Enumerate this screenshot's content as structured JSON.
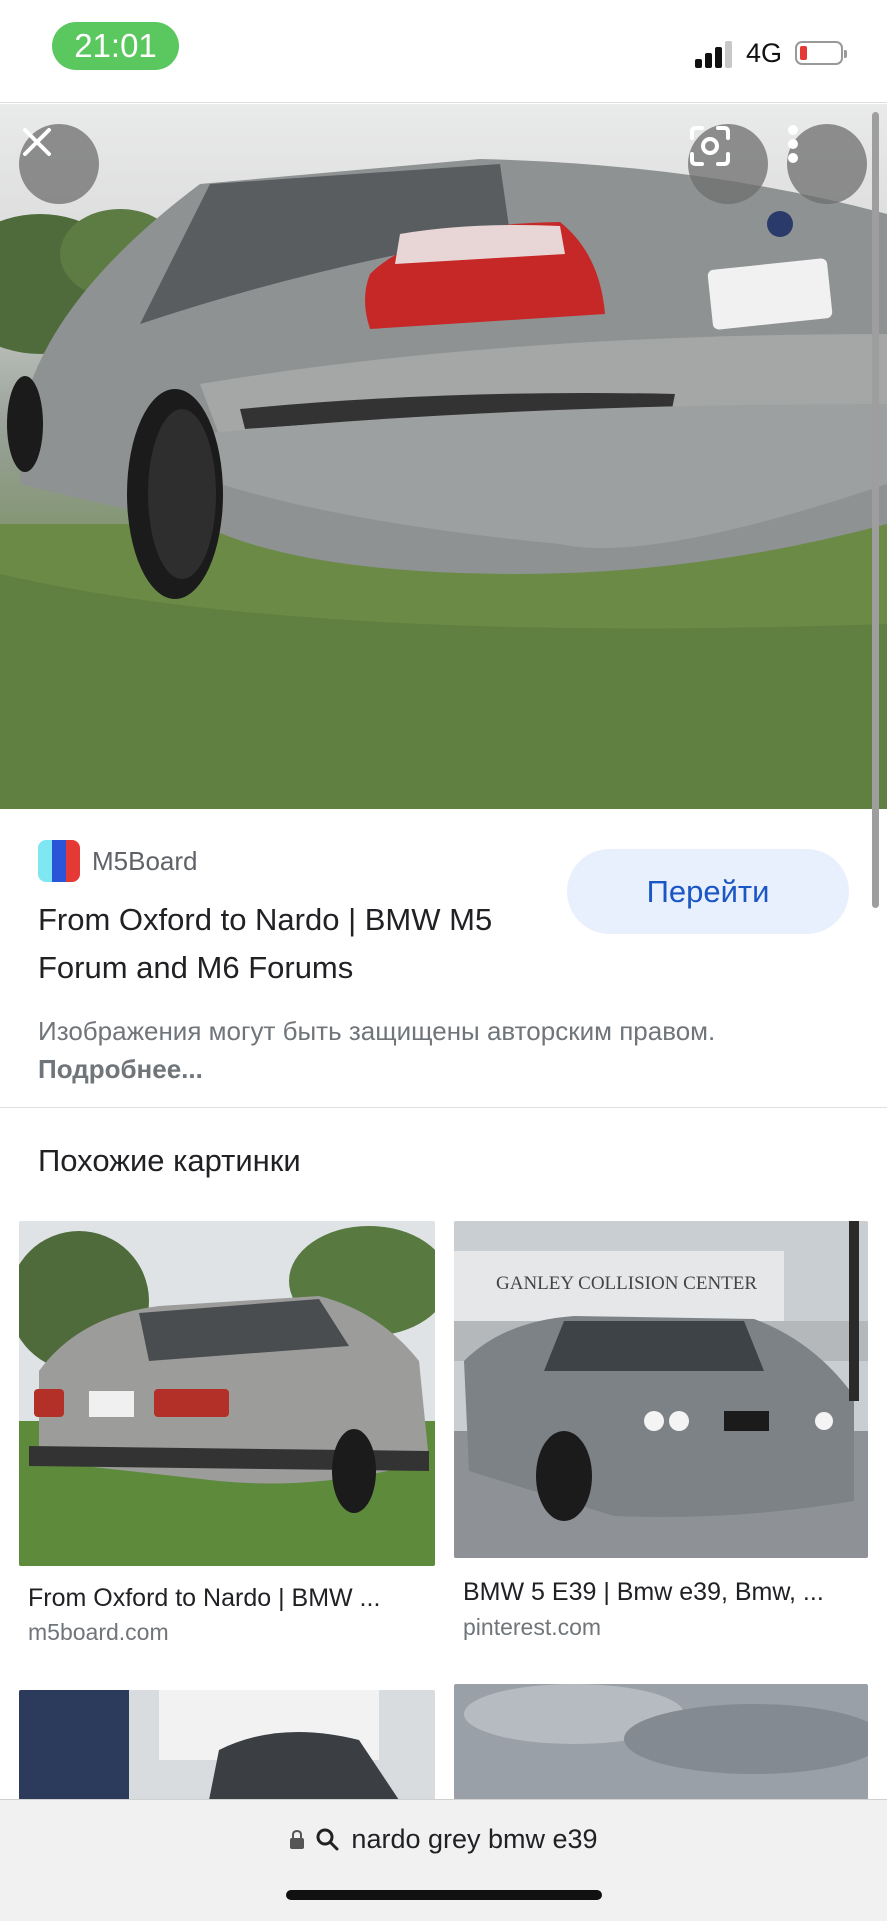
{
  "status_bar": {
    "time": "21:01",
    "network": "4G"
  },
  "image_toolbar": {
    "close_icon": "close-icon",
    "lens_icon": "lens-icon",
    "more_icon": "more-vertical-icon"
  },
  "result": {
    "source_name": "M5Board",
    "title": "From Oxford to Nardo | BMW M5 Forum and M6 Forums",
    "visit_label": "Перейти",
    "copyright_text": "Изображения могут быть защищены авторским правом.",
    "copyright_link": "Подробнее..."
  },
  "similar": {
    "heading": "Похожие картинки",
    "items": [
      {
        "title": "From Oxford to Nardo | BMW ...",
        "domain": "m5board.com"
      },
      {
        "title": "BMW 5 E39 | Bmw e39, Bmw, ...",
        "domain": "pinterest.com"
      }
    ],
    "overlay_text": "GANLEY COLLISION CENTER"
  },
  "address_bar": {
    "query": "nardo grey bmw e39"
  },
  "colors": {
    "accent": "#1a56c4",
    "button_bg": "#e8f0fe",
    "time_pill": "#5ac85f"
  }
}
